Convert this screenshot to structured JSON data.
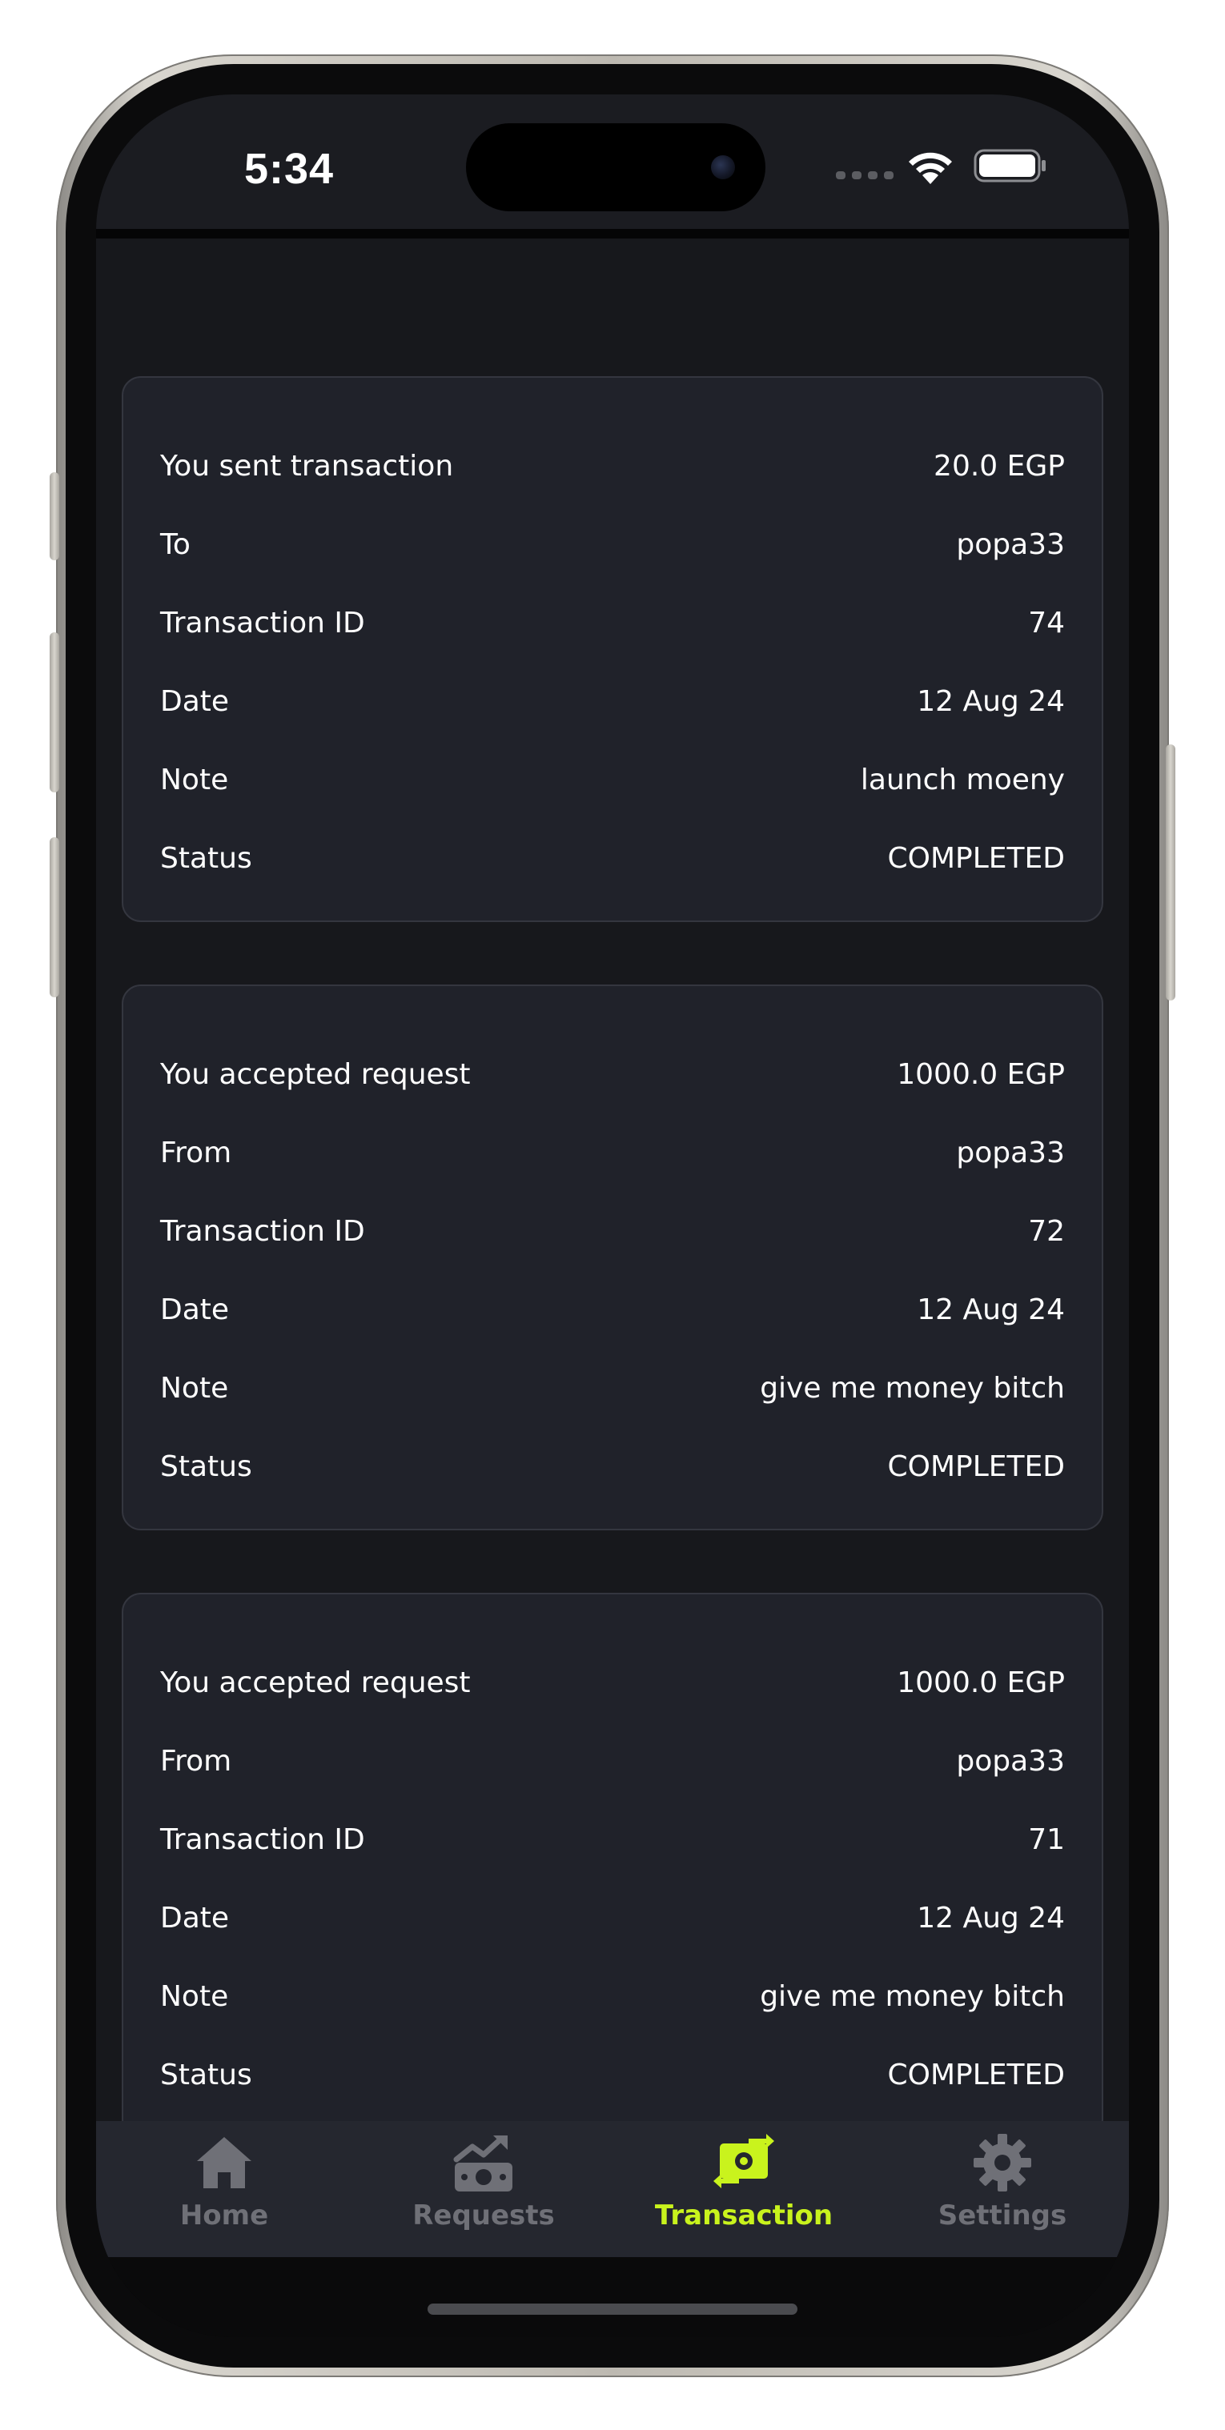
{
  "status_bar": {
    "time": "5:34"
  },
  "transactions": [
    {
      "rows": [
        {
          "label": "You sent transaction",
          "value": "20.0 EGP"
        },
        {
          "label": "To",
          "value": "popa33"
        },
        {
          "label": "Transaction ID",
          "value": "74"
        },
        {
          "label": "Date",
          "value": "12 Aug 24"
        },
        {
          "label": "Note",
          "value": "launch moeny"
        },
        {
          "label": "Status",
          "value": "COMPLETED"
        }
      ]
    },
    {
      "rows": [
        {
          "label": "You accepted request",
          "value": "1000.0 EGP"
        },
        {
          "label": "From",
          "value": "popa33"
        },
        {
          "label": "Transaction ID",
          "value": "72"
        },
        {
          "label": "Date",
          "value": "12 Aug 24"
        },
        {
          "label": "Note",
          "value": "give me money bitch"
        },
        {
          "label": "Status",
          "value": "COMPLETED"
        }
      ]
    },
    {
      "rows": [
        {
          "label": "You accepted request",
          "value": "1000.0 EGP"
        },
        {
          "label": "From",
          "value": "popa33"
        },
        {
          "label": "Transaction ID",
          "value": "71"
        },
        {
          "label": "Date",
          "value": "12 Aug 24"
        },
        {
          "label": "Note",
          "value": "give me money bitch"
        },
        {
          "label": "Status",
          "value": "COMPLETED"
        }
      ]
    }
  ],
  "bottom_nav": {
    "items": [
      {
        "label": "Home",
        "icon": "home-icon",
        "active": false
      },
      {
        "label": "Requests",
        "icon": "money-growth-icon",
        "active": false
      },
      {
        "label": "Transaction",
        "icon": "money-transfer-icon",
        "active": true
      },
      {
        "label": "Settings",
        "icon": "gear-icon",
        "active": false
      }
    ]
  },
  "colors": {
    "accent": "#c9f31d",
    "inactive": "#6f7077",
    "card_bg": "#20222a",
    "page_bg": "#17181c",
    "nav_bg": "#25272f"
  }
}
